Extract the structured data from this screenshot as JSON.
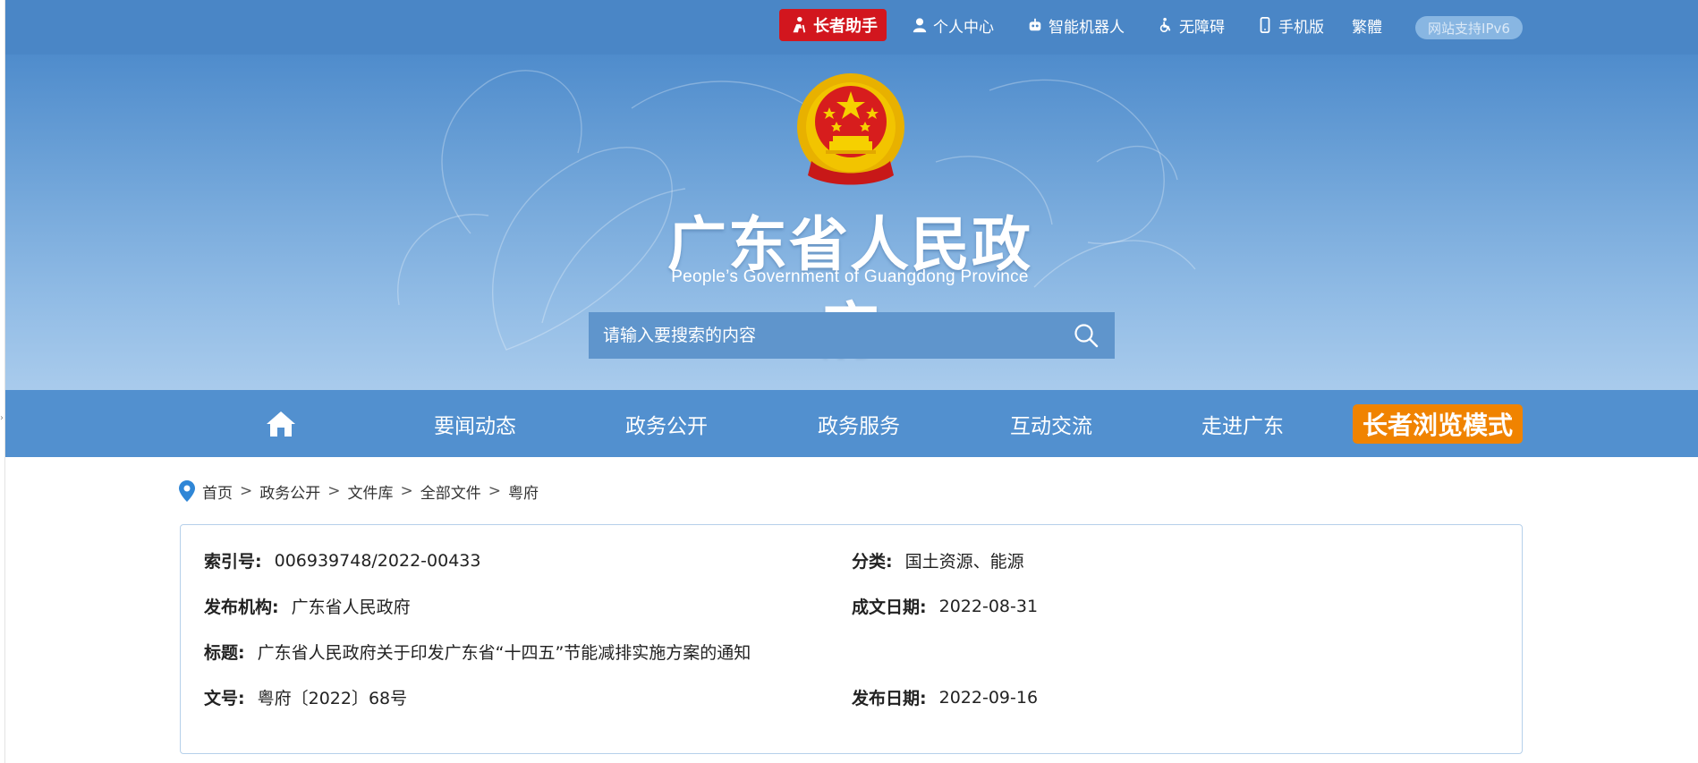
{
  "top_bar": {
    "elder_helper_label": "长者助手",
    "links": [
      {
        "label": "个人中心",
        "icon": "person-icon"
      },
      {
        "label": "智能机器人",
        "icon": "robot-icon"
      },
      {
        "label": "无障碍",
        "icon": "accessibility-icon"
      },
      {
        "label": "手机版",
        "icon": "mobile-icon"
      },
      {
        "label": "繁體",
        "icon": ""
      }
    ],
    "ipv6_label": "网站支持IPv6"
  },
  "header": {
    "title": "广东省人民政府",
    "subtitle": "People’s Government of Guangdong Province",
    "emblem_icon": "national-emblem-icon"
  },
  "search": {
    "placeholder": "请输入要搜索的内容",
    "button_icon": "search-icon"
  },
  "nav": {
    "home_icon": "home-icon",
    "items": [
      "要闻动态",
      "政务公开",
      "政务服务",
      "互动交流",
      "走进广东"
    ],
    "elder_mode_label": "长者浏览模式"
  },
  "breadcrumb": {
    "icon": "location-pin-icon",
    "items": [
      "首页",
      "政务公开",
      "文件库",
      "全部文件",
      "粤府"
    ],
    "separator": ">"
  },
  "document_info": {
    "index_no": {
      "label": "索引号:",
      "value": "006939748/2022-00433"
    },
    "category": {
      "label": "分类:",
      "value": "国土资源、能源"
    },
    "issuer": {
      "label": "发布机构:",
      "value": "广东省人民政府"
    },
    "written_date": {
      "label": "成文日期:",
      "value": "2022-08-31"
    },
    "title": {
      "label": "标题:",
      "value": "广东省人民政府关于印发广东省“十四五”节能减排实施方案的通知"
    },
    "doc_no": {
      "label": "文号:",
      "value": "粤府〔2022〕68号"
    },
    "publish_date": {
      "label": "发布日期:",
      "value": "2022-09-16"
    }
  },
  "colors": {
    "top_bar": "#4a86c6",
    "nav": "#5290cf",
    "elder_helper": "#d2161e",
    "elder_mode": "#f08300",
    "info_border": "#b6d0ea"
  }
}
